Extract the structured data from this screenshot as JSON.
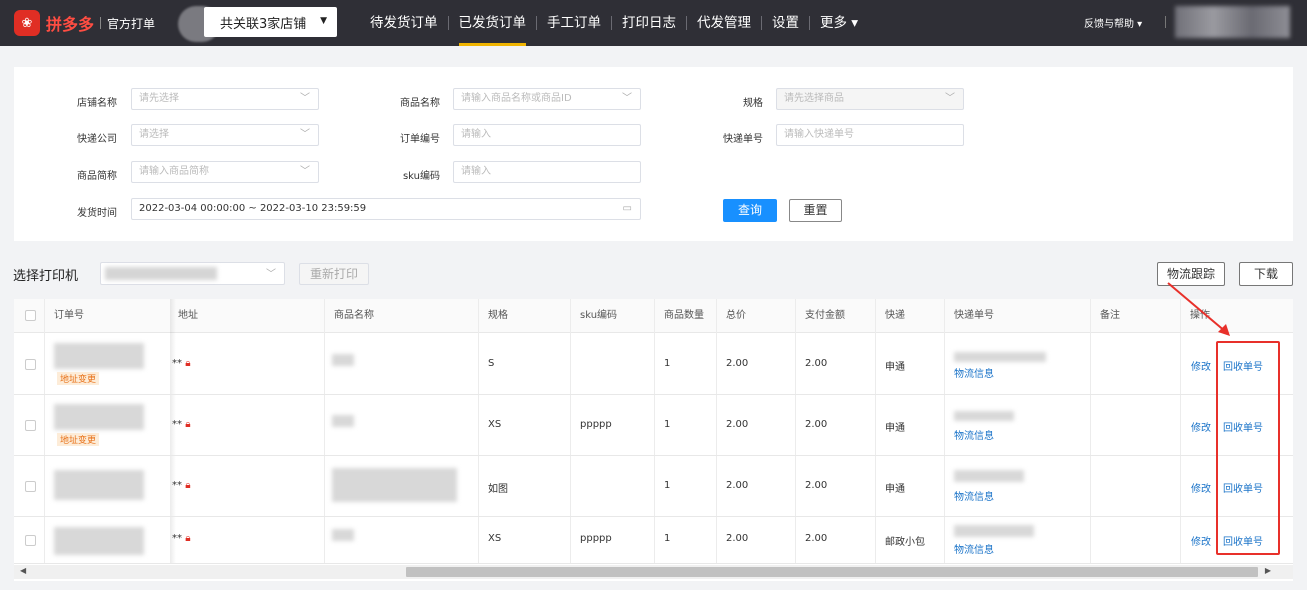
{
  "topbar": {
    "logo_text": "拼多多",
    "logo_sub": "官方打单",
    "shop_select": "共关联3家店铺",
    "nav": [
      "待发货订单",
      "已发货订单",
      "手工订单",
      "打印日志",
      "代发管理",
      "设置",
      "更多 ▾"
    ],
    "active_nav": "已发货订单",
    "help": "反馈与帮助 ▾"
  },
  "filter": {
    "shop_label": "店铺名称",
    "shop_placeholder": "请先选择",
    "goods_label": "商品名称",
    "goods_placeholder": "请输入商品名称或商品ID",
    "spec_label": "规格",
    "spec_placeholder": "请先选择商品",
    "express_label": "快递公司",
    "express_placeholder": "请选择",
    "order_label": "订单编号",
    "order_placeholder": "请输入",
    "tracking_label": "快递单号",
    "tracking_placeholder": "请输入快递单号",
    "short_label": "商品简称",
    "short_placeholder": "请输入商品简称",
    "sku_label": "sku编码",
    "sku_placeholder": "请输入",
    "time_label": "发货时间",
    "time_value": "2022-03-04 00:00:00 ~ 2022-03-10 23:59:59",
    "query_button": "查询",
    "reset_button": "重置"
  },
  "toolbar": {
    "printer_label": "选择打印机",
    "reprint_button": "重新打印",
    "track_button": "物流跟踪",
    "download_button": "下载"
  },
  "table": {
    "headers": [
      "订单号",
      "地址",
      "商品名称",
      "规格",
      "sku编码",
      "商品数量",
      "总价",
      "支付金额",
      "快递",
      "快递单号",
      "备注",
      "操作"
    ],
    "rows": [
      {
        "tag": "地址变更",
        "addr": "**",
        "spec": "S",
        "sku": "",
        "qty": "1",
        "total": "2.00",
        "paid": "2.00",
        "express": "申通",
        "logistics": "物流信息",
        "edit": "修改",
        "recycle": "回收单号"
      },
      {
        "tag": "地址变更",
        "addr": "**",
        "spec": "XS",
        "sku": "ppppp",
        "qty": "1",
        "total": "2.00",
        "paid": "2.00",
        "express": "申通",
        "logistics": "物流信息",
        "edit": "修改",
        "recycle": "回收单号"
      },
      {
        "tag": "",
        "addr": "**",
        "spec": "如图",
        "sku": "",
        "qty": "1",
        "total": "2.00",
        "paid": "2.00",
        "express": "申通",
        "logistics": "物流信息",
        "edit": "修改",
        "recycle": "回收单号"
      },
      {
        "tag": "",
        "addr": "**",
        "spec": "XS",
        "sku": "ppppp",
        "qty": "1",
        "total": "2.00",
        "paid": "2.00",
        "express": "邮政小包",
        "logistics": "物流信息",
        "edit": "修改",
        "recycle": "回收单号"
      }
    ]
  },
  "colors": {
    "accent": "#1890ff",
    "brand": "#e02e24",
    "highlight": "#e8302a",
    "nav_bg": "#2f2f36"
  }
}
